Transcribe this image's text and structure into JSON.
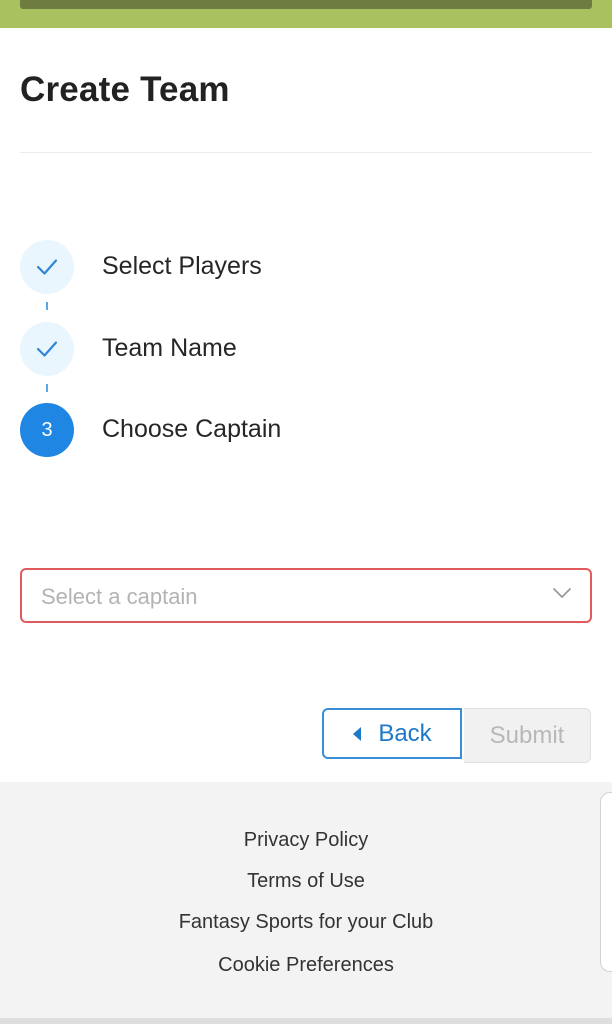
{
  "header": {
    "title": "Create Team"
  },
  "steps": [
    {
      "label": "Select Players",
      "state": "complete",
      "icon": "check-icon"
    },
    {
      "label": "Team Name",
      "state": "complete",
      "icon": "check-icon"
    },
    {
      "label": "Choose Captain",
      "state": "active",
      "number": "3"
    }
  ],
  "captain_select": {
    "placeholder": "Select a captain",
    "icon": "chevron-down-icon"
  },
  "actions": {
    "back_label": "Back",
    "submit_label": "Submit"
  },
  "footer": {
    "links": [
      "Privacy Policy",
      "Terms of Use",
      "Fantasy Sports for your Club",
      "Cookie Preferences"
    ]
  },
  "colors": {
    "accent": "#1f86e3",
    "error_border": "#e05c5c",
    "banner": "#a9c15f",
    "footer_bg": "#f3f3f3"
  }
}
